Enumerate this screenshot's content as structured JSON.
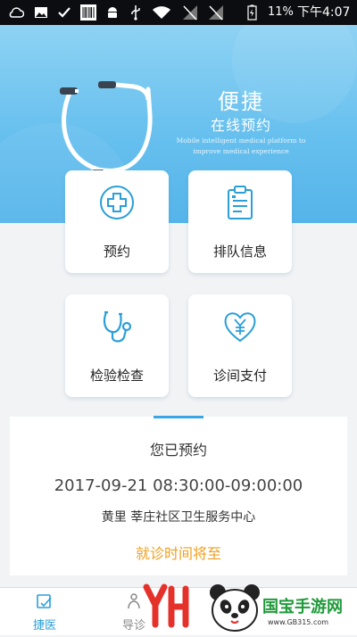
{
  "status_bar": {
    "battery_percent": "11%",
    "time": "下午4:07",
    "icons": [
      "cloud-icon",
      "image-icon",
      "check-icon",
      "barcode-icon",
      "android-icon",
      "usb-icon",
      "wifi-icon",
      "no-signal-icon",
      "no-signal-icon",
      "battery-charging-icon"
    ]
  },
  "hero": {
    "title": "便捷",
    "subtitle": "在线预约",
    "tagline": "Mobile intelligent medical platform to improve medical experience",
    "illustration": "stethoscope"
  },
  "tiles": [
    {
      "label": "预约",
      "icon": "medical-cross-icon"
    },
    {
      "label": "排队信息",
      "icon": "clipboard-icon"
    },
    {
      "label": "检验检查",
      "icon": "stethoscope-icon"
    },
    {
      "label": "诊间支付",
      "icon": "heart-yuan-icon"
    }
  ],
  "appointment": {
    "title": "您已预约",
    "datetime": "2017-09-21 08:30:00-09:00:00",
    "location": "黄里 莘庄社区卫生服务中心",
    "status": "就诊时间将至"
  },
  "tabbar": {
    "tabs": [
      {
        "label": "捷医",
        "icon": "home-doc-icon",
        "active": true
      },
      {
        "label": "导诊",
        "icon": "guide-icon",
        "active": false
      }
    ]
  },
  "watermark": {
    "logo_text": "YH",
    "site_name": "国宝手游网",
    "url": "www.GB315.com"
  },
  "colors": {
    "accent": "#3aa6e6",
    "hero_top": "#8ed2f4",
    "status_orange": "#f0a020",
    "icon_blue": "#2a9fd8"
  }
}
